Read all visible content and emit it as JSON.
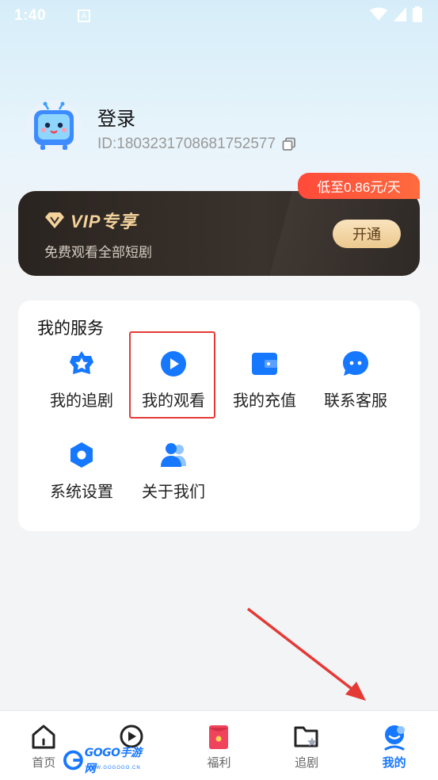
{
  "status_bar": {
    "time": "1:40",
    "notif_glyph": "A"
  },
  "profile": {
    "login_label": "登录",
    "user_id": "ID:1803231708681752577"
  },
  "vip": {
    "badge": "低至0.86元/天",
    "title": "VIP专享",
    "subtitle": "免费观看全部短剧",
    "button": "开通"
  },
  "services": {
    "title": "我的服务",
    "items": [
      {
        "label": "我的追剧",
        "icon": "star-icon"
      },
      {
        "label": "我的观看",
        "icon": "play-icon"
      },
      {
        "label": "我的充值",
        "icon": "wallet-icon"
      },
      {
        "label": "联系客服",
        "icon": "chat-icon"
      },
      {
        "label": "系统设置",
        "icon": "settings-icon"
      },
      {
        "label": "关于我们",
        "icon": "users-icon"
      }
    ]
  },
  "tabbar": {
    "items": [
      {
        "label": "首页",
        "icon": "home-icon",
        "active": false
      },
      {
        "label": "",
        "icon": "theater-play-icon",
        "active": false
      },
      {
        "label": "福利",
        "icon": "gift-icon",
        "active": false
      },
      {
        "label": "追剧",
        "icon": "folder-star-icon",
        "active": false
      },
      {
        "label": "我的",
        "icon": "profile-icon",
        "active": true
      }
    ]
  },
  "watermark": {
    "text": "GOGO手游网",
    "sub": "WWW.GOGOGO.CN"
  },
  "colors": {
    "accent": "#1677ff",
    "vip_gold": "#f3d29c",
    "badge_red": "#ff4a3a",
    "highlight": "#e53935"
  }
}
